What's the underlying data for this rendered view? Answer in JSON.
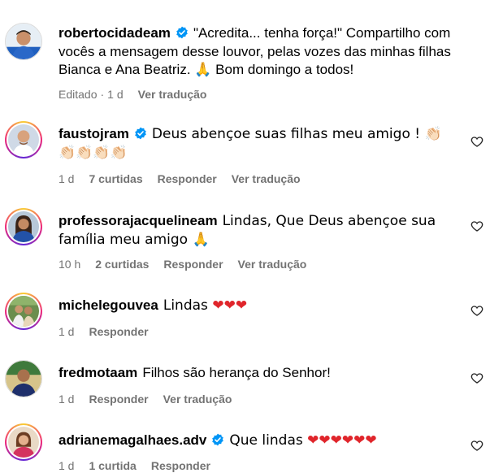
{
  "caption": {
    "username": "robertocidadeam",
    "text": "\"Acredita... tenha força!\" Compartilho com vocês a mensagem desse louvor, pelas vozes das minhas filhas Bianca e Ana Beatriz. 🙏 Bom domingo a todos!",
    "edited": "Editado",
    "sep": "·",
    "time": "1 d",
    "translate": "Ver tradução"
  },
  "comments": [
    {
      "username": "faustojram",
      "verified": true,
      "text": "Deus abençoe suas filhas meu amigo ! 👏🏻👏🏻👏🏻👏🏻👏🏻",
      "time": "1 d",
      "likes": "7 curtidas",
      "reply": "Responder",
      "translate": "Ver tradução"
    },
    {
      "username": "professorajacquelineam",
      "verified": false,
      "text": "Lindas, Que Deus abençoe sua família meu amigo 🙏",
      "time": "10 h",
      "likes": "2 curtidas",
      "reply": "Responder",
      "translate": "Ver tradução"
    },
    {
      "username": "michelegouvea",
      "verified": false,
      "text": "Lindas ❤❤❤",
      "time": "1 d",
      "reply": "Responder"
    },
    {
      "username": "fredmotaam",
      "verified": false,
      "text": "Filhos são herança do Senhor!",
      "time": "1 d",
      "reply": "Responder",
      "translate": "Ver tradução"
    },
    {
      "username": "adrianemagalhaes.adv",
      "verified": true,
      "text": "Que lindas ❤❤❤❤❤❤",
      "time": "1 d",
      "likes": "1 curtida",
      "reply": "Responder"
    }
  ],
  "icons": {
    "verified": "verified-badge-icon",
    "like": "heart-outline-icon",
    "accent_blue": "#0095f6",
    "meta_grey": "#737373",
    "heart_red": "#e0252b"
  }
}
